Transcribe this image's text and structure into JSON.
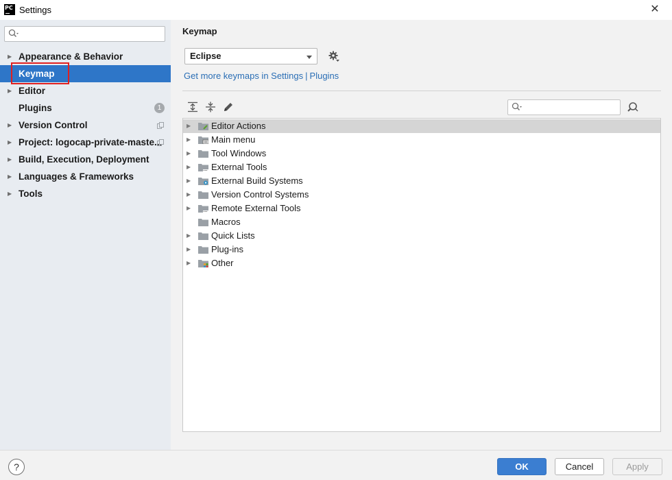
{
  "window": {
    "app_icon_text": "PC",
    "title": "Settings",
    "close_glyph": "✕"
  },
  "sidebar": {
    "search": {
      "value": "",
      "placeholder": ""
    },
    "items": [
      {
        "label": "Appearance & Behavior",
        "expandable": true,
        "selected": false
      },
      {
        "label": "Keymap",
        "expandable": false,
        "selected": true
      },
      {
        "label": "Editor",
        "expandable": true,
        "selected": false
      },
      {
        "label": "Plugins",
        "expandable": false,
        "selected": false,
        "badge": "1"
      },
      {
        "label": "Version Control",
        "expandable": true,
        "selected": false,
        "icon": "copy-icon"
      },
      {
        "label": "Project: logocap-private-maste...",
        "expandable": true,
        "selected": false,
        "icon": "copy-icon"
      },
      {
        "label": "Build, Execution, Deployment",
        "expandable": true,
        "selected": false
      },
      {
        "label": "Languages & Frameworks",
        "expandable": true,
        "selected": false
      },
      {
        "label": "Tools",
        "expandable": true,
        "selected": false
      }
    ]
  },
  "main": {
    "title": "Keymap",
    "keymap_select": {
      "value": "Eclipse"
    },
    "link": {
      "prefix": "Get more keymaps in Settings",
      "separator": "|",
      "plugins": "Plugins"
    },
    "filter": {
      "value": "",
      "placeholder": ""
    },
    "toolbar_icons": [
      "expand-all-icon",
      "collapse-all-icon",
      "edit-icon"
    ],
    "tree": [
      {
        "label": "Editor Actions",
        "expandable": true,
        "selected": true,
        "icon": "editor-actions-folder-icon"
      },
      {
        "label": "Main menu",
        "expandable": true,
        "selected": false,
        "icon": "menu-folder-icon"
      },
      {
        "label": "Tool Windows",
        "expandable": true,
        "selected": false,
        "icon": "folder-icon"
      },
      {
        "label": "External Tools",
        "expandable": true,
        "selected": false,
        "icon": "external-tools-folder-icon"
      },
      {
        "label": "External Build Systems",
        "expandable": true,
        "selected": false,
        "icon": "build-systems-folder-icon"
      },
      {
        "label": "Version Control Systems",
        "expandable": true,
        "selected": false,
        "icon": "folder-icon"
      },
      {
        "label": "Remote External Tools",
        "expandable": true,
        "selected": false,
        "icon": "external-tools-folder-icon"
      },
      {
        "label": "Macros",
        "expandable": false,
        "selected": false,
        "icon": "folder-icon"
      },
      {
        "label": "Quick Lists",
        "expandable": true,
        "selected": false,
        "icon": "folder-icon"
      },
      {
        "label": "Plug-ins",
        "expandable": true,
        "selected": false,
        "icon": "folder-icon"
      },
      {
        "label": "Other",
        "expandable": true,
        "selected": false,
        "icon": "other-folder-icon"
      }
    ]
  },
  "footer": {
    "help_label": "?",
    "ok_label": "OK",
    "cancel_label": "Cancel",
    "apply_label": "Apply"
  },
  "colors": {
    "accent": "#2e76c8",
    "selection_highlight": "#e02020",
    "link": "#2a6eb5",
    "sidebar_bg": "#e8ecf1"
  }
}
